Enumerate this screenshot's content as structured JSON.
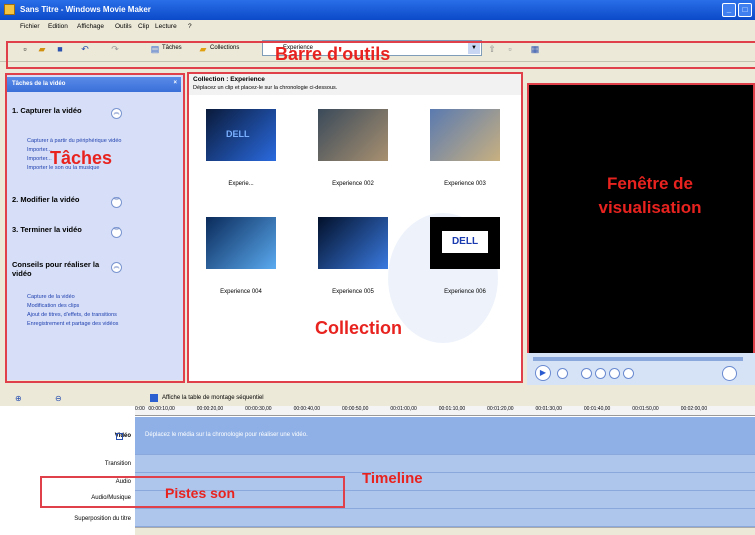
{
  "window": {
    "title": "Sans Titre - Windows Movie Maker"
  },
  "menu": [
    "Fichier",
    "Edition",
    "Affichage",
    "Outils",
    "Clip",
    "Lecture",
    "?"
  ],
  "toolbar": {
    "taches_label": "Tâches",
    "collections_label": "Collections",
    "collection_select": "Experience"
  },
  "callouts": {
    "toolbar": "Barre d'outils",
    "tasks": "Tâches",
    "collection": "Collection",
    "viewer": "Fenêtre de visualisation",
    "timeline": "Timeline",
    "sound": "Pistes son"
  },
  "tasks": {
    "header": "Tâches de la vidéo",
    "sections": [
      {
        "title": "1. Capturer la vidéo",
        "links": [
          "Capturer à partir du périphérique vidéo",
          "Importer...",
          "Importer...",
          "Importer le son ou la musique"
        ]
      },
      {
        "title": "2. Modifier la vidéo",
        "links": []
      },
      {
        "title": "3. Terminer la vidéo",
        "links": []
      },
      {
        "title": "Conseils pour réaliser la vidéo",
        "links": [
          "Capture de la vidéo",
          "Modification des clips",
          "Ajout de titres, d'effets, de transitions",
          "Enregistrement et partage des vidéos"
        ]
      }
    ]
  },
  "collection": {
    "title": "Collection : Experience",
    "subtitle": "Déplacez un clip et placez-le sur la chronologie ci-dessous.",
    "clips": [
      {
        "label": "Experie...",
        "color1": "#0a1a3a",
        "color2": "#2a6adf",
        "text": "DELL"
      },
      {
        "label": "Experience 002",
        "color1": "#3a4a5a",
        "color2": "#a89070",
        "text": ""
      },
      {
        "label": "Experience 003",
        "color1": "#5a7ab0",
        "color2": "#c8b080",
        "text": ""
      },
      {
        "label": "Experience 004",
        "color1": "#0a2a5a",
        "color2": "#5aaaf0",
        "text": ""
      },
      {
        "label": "Experience 005",
        "color1": "#02102a",
        "color2": "#3a7ae0",
        "text": ""
      },
      {
        "label": "Experience 006",
        "color1": "#000000",
        "color2": "#000000",
        "text": "DELL"
      }
    ]
  },
  "timeline": {
    "toggle_label": "Affiche la table de montage séquentiel",
    "ruler": [
      "0:00",
      "00:00:10,00",
      "00:00:20,00",
      "00:00:30,00",
      "00:00:40,00",
      "00:00:50,00",
      "00:01:00,00",
      "00:01:10,00",
      "00:01:20,00",
      "00:01:30,00",
      "00:01:40,00",
      "00:01:50,00",
      "00:02:00,00"
    ],
    "tracks": [
      "Vidéo",
      "Transition",
      "Audio",
      "Audio/Musique",
      "Superposition du titre"
    ],
    "video_hint": "Déplacez le média sur la chronologie pour réaliser une vidéo."
  }
}
